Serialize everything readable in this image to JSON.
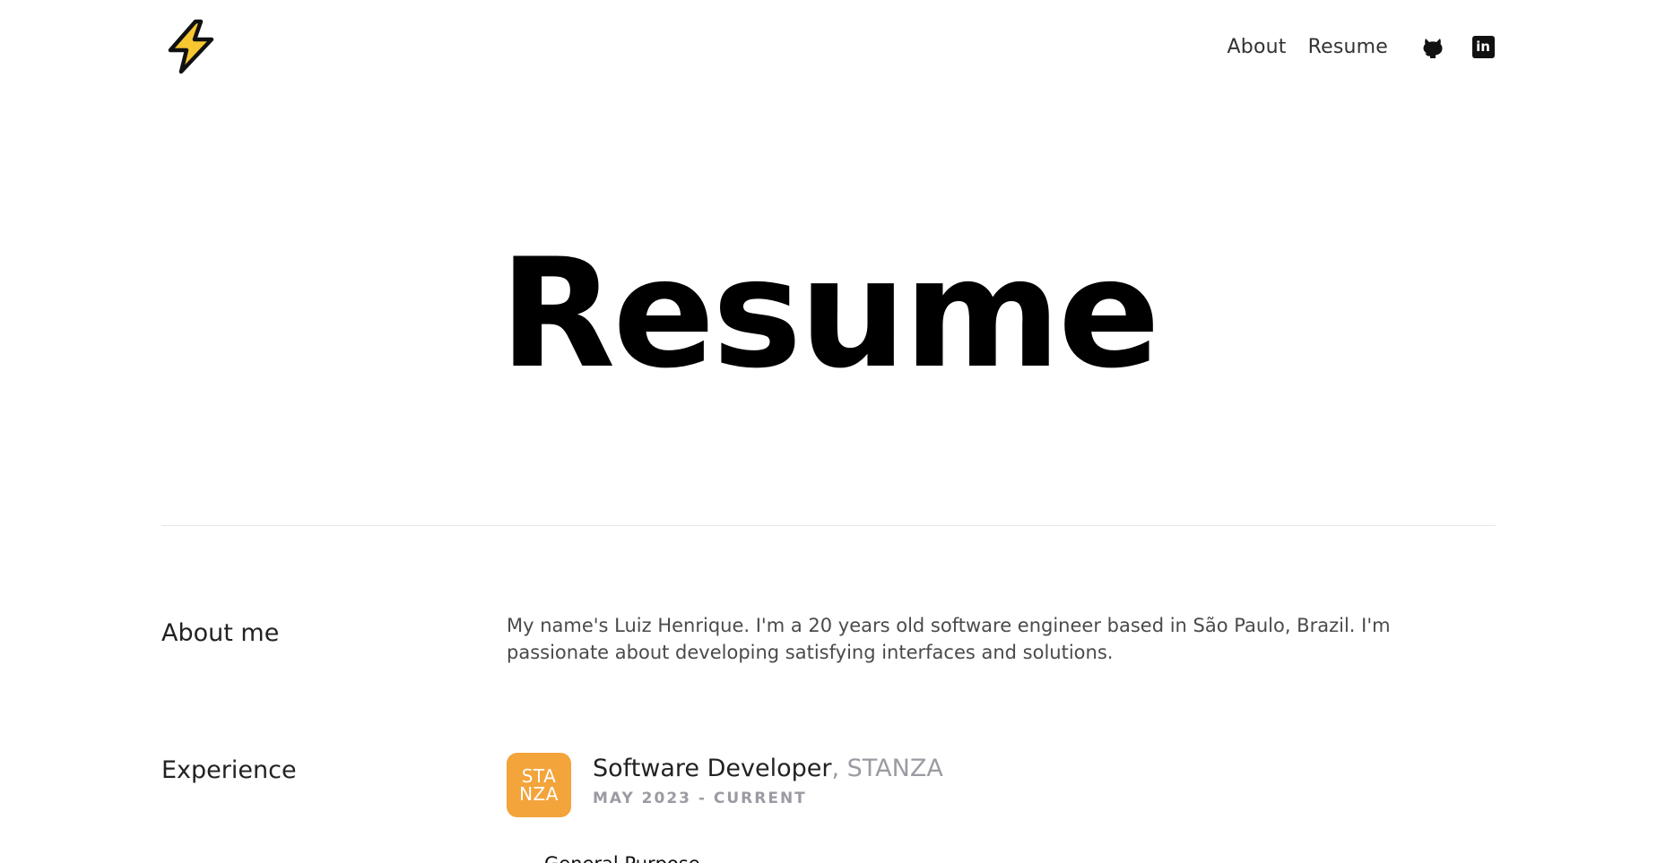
{
  "nav": {
    "links": [
      "About",
      "Resume"
    ],
    "social": [
      {
        "name": "github",
        "icon": "github-icon"
      },
      {
        "name": "linkedin",
        "icon": "linkedin-icon",
        "glyph": "in"
      }
    ]
  },
  "logo": {
    "icon": "lightning-bolt-icon",
    "colors": {
      "fill": "#f7c631",
      "stroke": "#111111"
    }
  },
  "hero": {
    "title": "Resume"
  },
  "about": {
    "heading": "About me",
    "text": "My name's Luiz Henrique. I'm a 20 years old software engineer based in São Paulo, Brazil. I'm passionate about developing satisfying interfaces and solutions."
  },
  "experience": {
    "heading": "Experience",
    "jobs": [
      {
        "logo_line1": "STA",
        "logo_line2": "NZA",
        "logo_color": "#f3a43a",
        "title": "Software Developer",
        "company": ", STANZA",
        "dates": "MAY 2023 - CURRENT",
        "items": [
          "General Purpose"
        ]
      }
    ]
  }
}
